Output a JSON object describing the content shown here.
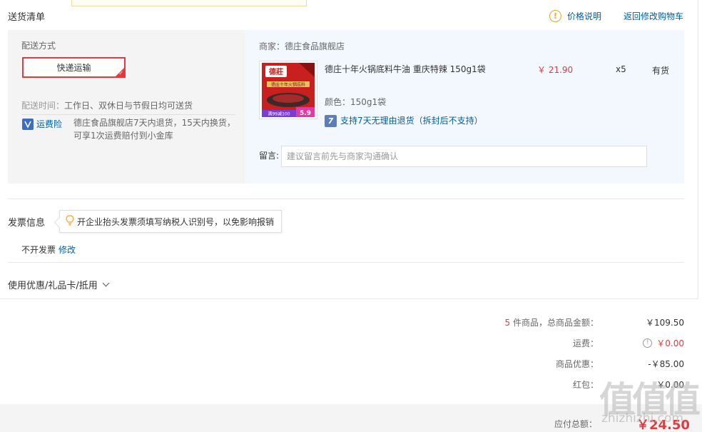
{
  "header": {
    "section_title": "送货清单",
    "price_note": "价格说明",
    "back_to_cart": "返回修改购物车"
  },
  "shipping": {
    "method_label": "配送方式",
    "method_selected": "快递运输",
    "time_prefix": "配送时间：",
    "time_value": "工作日、双休日与节假日均可送货",
    "insurance_label": "运费险",
    "insurance_desc": "德庄食品旗舰店7天内退货，15天内换货，可享1次运费赔付到小金库"
  },
  "order": {
    "merchant": "商家：德庄食品旗舰店",
    "product": {
      "name": "德庄十年火锅底料牛油 重庆特辣 150g1袋",
      "price": "￥ 21.90",
      "quantity": "x5",
      "stock": "有货",
      "color": "颜色：150g1袋",
      "return_policy": "支持7天无理由退货（拆封后不支持）",
      "image_brand": "德莊",
      "image_caption": "德庄十年火锅底料",
      "image_promo": "满99减100",
      "image_price": "5.9"
    },
    "message_label": "留言:",
    "message_placeholder": "建议留言前先与商家沟通确认"
  },
  "invoice": {
    "title": "发票信息",
    "tip": "开企业抬头发票须填写纳税人识别号，以免影响报销",
    "status": "不开发票",
    "edit": "修改"
  },
  "coupon": {
    "label": "使用优惠/礼品卡/抵用"
  },
  "summary": {
    "count": "5",
    "count_label": "件商品，总商品金额：",
    "goods_total": "￥109.50",
    "freight_label": "运费：",
    "freight_value": "￥0.00",
    "discount_label": "商品优惠：",
    "discount_value": "-￥85.00",
    "redpacket_label": "红包：",
    "redpacket_value": "￥0.00",
    "payable_label": "应付总额：",
    "payable_value": "￥24.50"
  },
  "watermark": {
    "logo": "值值值",
    "url": "zhizhizhi.com"
  },
  "colors": {
    "accent_red": "#e4393c",
    "link_blue": "#005ea7",
    "warning_orange": "#e5a72a"
  }
}
